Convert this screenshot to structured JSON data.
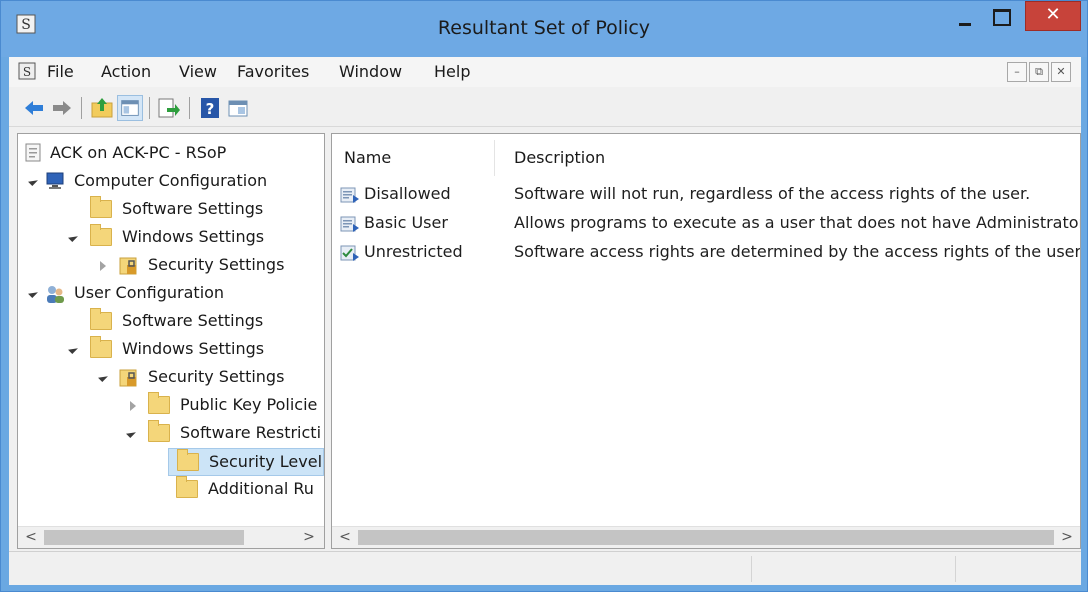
{
  "window": {
    "title": "Resultant Set of Policy",
    "close_glyph": "✕",
    "accent": "#6ea9e4",
    "close_color": "#c7433a"
  },
  "menu": {
    "items": [
      "File",
      "Action",
      "View",
      "Favorites",
      "Window",
      "Help"
    ],
    "mdi_minimize": "–",
    "mdi_restore": "⧉",
    "mdi_close": "✕"
  },
  "toolbar": {
    "buttons": [
      "back-arrow-icon",
      "forward-arrow-icon",
      "up-folder-icon",
      "show-hide-tree-icon",
      "export-list-icon",
      "help-icon",
      "properties-icon"
    ]
  },
  "tree": {
    "root": "ACK on ACK-PC - RSoP",
    "computer_config": "Computer Configuration",
    "cc_software_settings": "Software Settings",
    "cc_windows_settings": "Windows Settings",
    "cc_security_settings": "Security Settings",
    "user_config": "User Configuration",
    "uc_software_settings": "Software Settings",
    "uc_windows_settings": "Windows Settings",
    "uc_security_settings": "Security Settings",
    "public_key_policies": "Public Key Policie",
    "software_restriction": "Software Restricti",
    "security_levels": "Security Level",
    "additional_rules": "Additional Ru"
  },
  "list": {
    "columns": [
      "Name",
      "Description"
    ],
    "rows": [
      {
        "name": "Disallowed",
        "description": "Software will not run, regardless of the access rights of the user."
      },
      {
        "name": "Basic User",
        "description": "Allows programs to execute as a user that does not have Administrator ."
      },
      {
        "name": "Unrestricted",
        "description": "Software access rights are determined by the access rights of the user."
      }
    ]
  },
  "scroll": {
    "left": "<",
    "right": ">"
  }
}
